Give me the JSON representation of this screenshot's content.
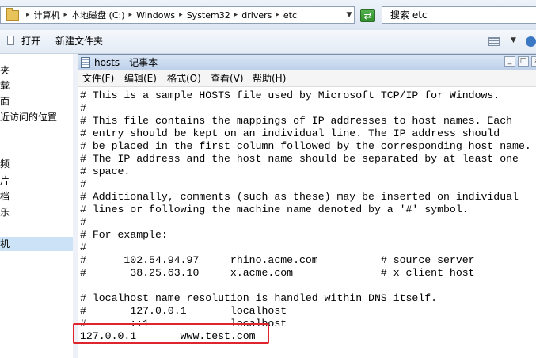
{
  "address_bar": {
    "crumbs": [
      "计算机",
      "本地磁盘 (C:)",
      "Windows",
      "System32",
      "drivers",
      "etc"
    ],
    "separator": "▸",
    "search_text": "搜索 etc"
  },
  "toolbar": {
    "open_label": "打开",
    "new_folder_label": "新建文件夹"
  },
  "nav_pane": {
    "items": [
      {
        "label": "夹",
        "selected": false
      },
      {
        "label": "载",
        "selected": false
      },
      {
        "label": "面",
        "selected": false
      },
      {
        "label": "近访问的位置",
        "selected": false
      },
      {
        "label": "频",
        "selected": false
      },
      {
        "label": "片",
        "selected": false
      },
      {
        "label": "档",
        "selected": false
      },
      {
        "label": "乐",
        "selected": false
      },
      {
        "label": "机",
        "selected": true
      }
    ]
  },
  "notepad": {
    "title": "hosts - 记事本",
    "menu": [
      "文件(F)",
      "编辑(E)",
      "格式(O)",
      "查看(V)",
      "帮助(H)"
    ],
    "lines": [
      "# This is a sample HOSTS file used by Microsoft TCP/IP for Windows.",
      "#",
      "# This file contains the mappings of IP addresses to host names. Each",
      "# entry should be kept on an individual line. The IP address should",
      "# be placed in the first column followed by the corresponding host name.",
      "# The IP address and the host name should be separated by at least one",
      "# space.",
      "#",
      "# Additionally, comments (such as these) may be inserted on individual",
      "# lines or following the machine name denoted by a '#' symbol.",
      "#",
      "# For example:",
      "#",
      "#      102.54.94.97     rhino.acme.com          # source server",
      "#       38.25.63.10     x.acme.com              # x client host",
      "",
      "# localhost name resolution is handled within DNS itself.",
      "#       127.0.0.1       localhost",
      "#       ::1             localhost",
      "127.0.0.1       www.test.com"
    ]
  },
  "colors": {
    "highlight_box": "#e0242b",
    "selection": "#cce3f7"
  }
}
